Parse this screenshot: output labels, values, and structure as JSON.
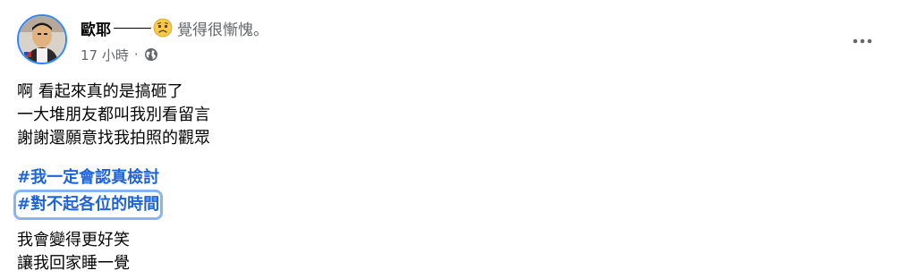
{
  "post": {
    "author": "歐耶",
    "feeling_emoji": "sad-face-icon",
    "feeling_text": "覺得很慚愧。",
    "timestamp": "17 小時",
    "separator": "·",
    "privacy_icon": "globe-icon",
    "more_icon": "more-options-icon",
    "body_lines": [
      "啊 看起來真的是搞砸了",
      "一大堆朋友都叫我別看留言",
      "謝謝還願意找我拍照的觀眾"
    ],
    "hashtags": [
      "#我一定會認真檢討",
      "#對不起各位的時間"
    ],
    "closing_lines": [
      "我會變得更好笑",
      "讓我回家睡一覺"
    ]
  },
  "colors": {
    "hashtag": "#1c64d8",
    "secondary_text": "#65676b",
    "focus_ring": "#88b4f1",
    "avatar_ring": "#2d88ff"
  }
}
